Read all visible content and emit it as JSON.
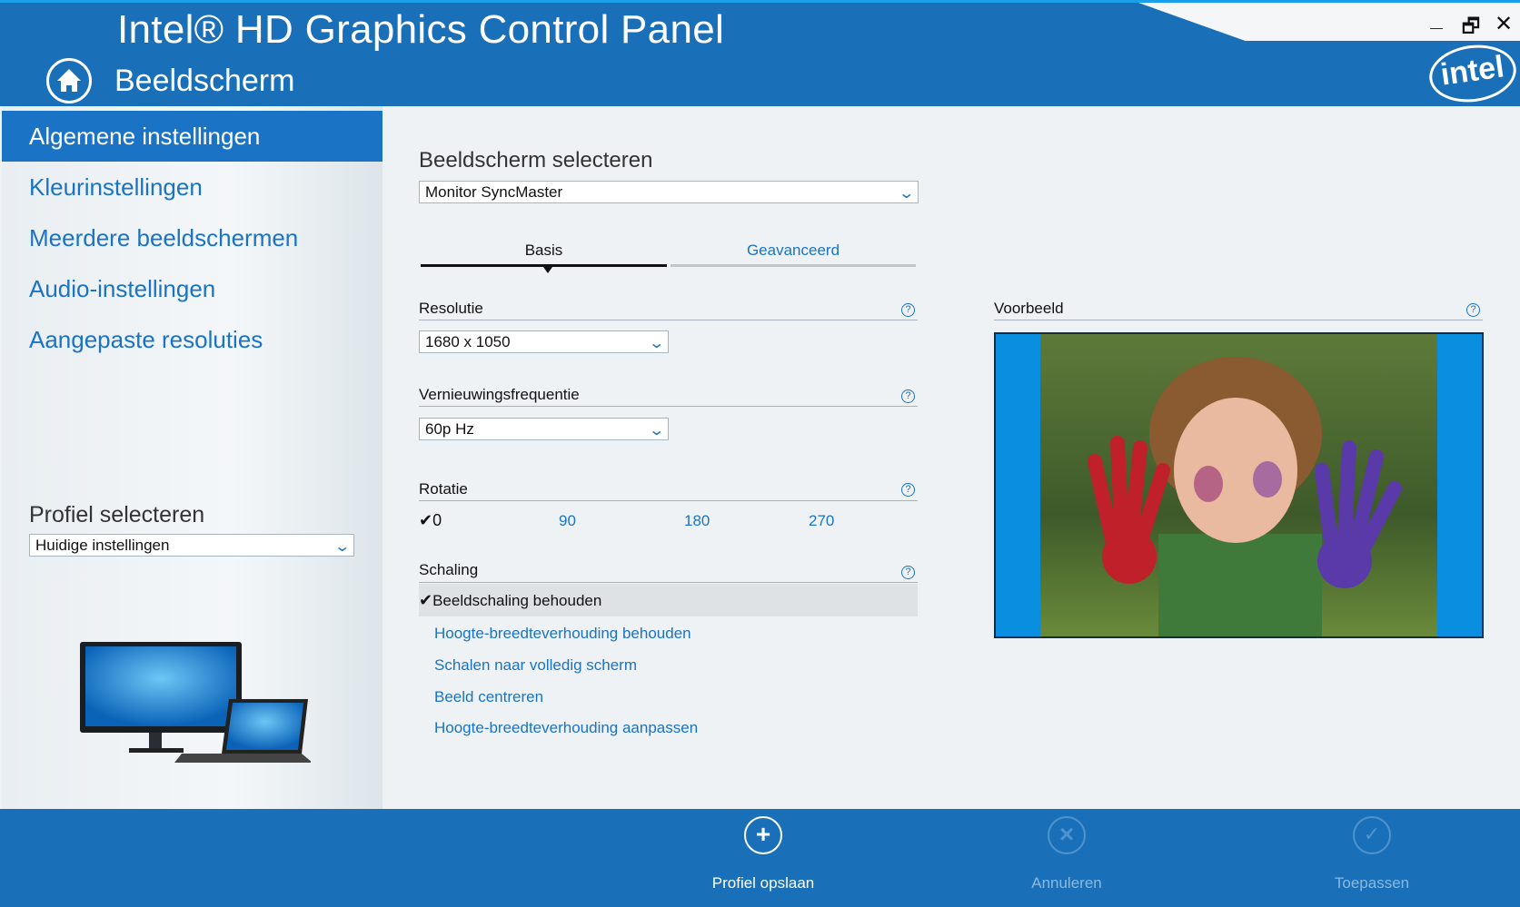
{
  "window": {
    "title": "Intel® HD Graphics Control Panel",
    "section": "Beeldscherm",
    "minimize": "_",
    "restore": "🗗",
    "close": "✕",
    "logo": "intel"
  },
  "sidebar": {
    "items": [
      {
        "label": "Algemene instellingen",
        "selected": true
      },
      {
        "label": "Kleurinstellingen"
      },
      {
        "label": "Meerdere beeldschermen"
      },
      {
        "label": "Audio-instellingen"
      },
      {
        "label": "Aangepaste resoluties"
      }
    ],
    "profile_label": "Profiel selecteren",
    "profile_value": "Huidige instellingen"
  },
  "main": {
    "display_label": "Beeldscherm selecteren",
    "display_value": "Monitor SyncMaster",
    "tabs": [
      {
        "label": "Basis",
        "active": true
      },
      {
        "label": "Geavanceerd"
      }
    ],
    "resolution_label": "Resolutie",
    "resolution_value": "1680 x 1050",
    "refresh_label": "Vernieuwingsfrequentie",
    "refresh_value": "60p Hz",
    "rotation_label": "Rotatie",
    "rotation_check": "✔",
    "rotation_options": [
      "0",
      "90",
      "180",
      "270"
    ],
    "scaling_label": "Schaling",
    "scaling_check": "✔",
    "scaling_options": [
      "Beeldschaling behouden",
      "Hoogte-breedteverhouding behouden",
      "Schalen naar volledig scherm",
      "Beeld centreren",
      "Hoogte-breedteverhouding aanpassen"
    ],
    "help": "?",
    "preview_label": "Voorbeeld"
  },
  "footer": {
    "save": "Profiel opslaan",
    "cancel": "Annuleren",
    "apply": "Toepassen",
    "save_icon": "+",
    "cancel_icon": "×",
    "apply_icon": "✓"
  },
  "colors": {
    "brand": "#1a70b8",
    "accent": "#1a73c4"
  }
}
